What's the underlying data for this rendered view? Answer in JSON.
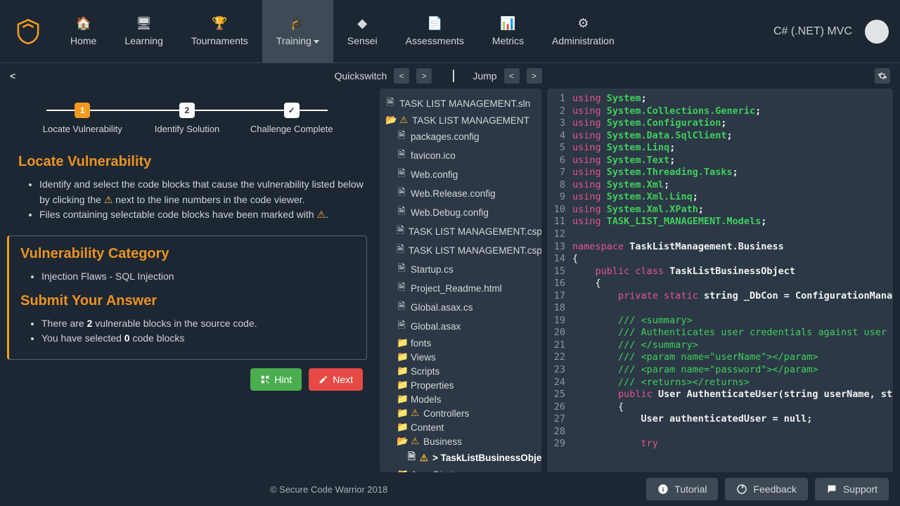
{
  "nav": {
    "items": [
      {
        "label": "Home"
      },
      {
        "label": "Learning"
      },
      {
        "label": "Tournaments"
      },
      {
        "label": "Training"
      },
      {
        "label": "Sensei"
      },
      {
        "label": "Assessments"
      },
      {
        "label": "Metrics"
      },
      {
        "label": "Administration"
      }
    ],
    "language": "C# (.NET) MVC"
  },
  "toolbar": {
    "quickswitch": "Quickswitch",
    "jump": "Jump"
  },
  "stepper": {
    "s1": "Locate Vulnerability",
    "s2": "Identify Solution",
    "s3": "Challenge Complete",
    "n1": "1",
    "n2": "2",
    "n3": "✓"
  },
  "left": {
    "heading1": "Locate Vulnerability",
    "inst1_a": "Identify and select the code blocks that cause the vulnerability listed below by clicking the ",
    "inst1_b": " next to the line numbers in the code viewer.",
    "inst2_a": "Files containing selectable code blocks have been marked with ",
    "inst2_b": ".",
    "cat_heading": "Vulnerability Category",
    "cat_value": "Injection Flaws - SQL Injection",
    "ans_heading": "Submit Your Answer",
    "ans1_a": "There are ",
    "ans1_b": "2",
    "ans1_c": " vulnerable blocks in the source code.",
    "ans2_a": "You have selected ",
    "ans2_b": "0",
    "ans2_c": " code blocks",
    "hint": "Hint",
    "next": "Next"
  },
  "tree": [
    {
      "depth": 0,
      "icon": "file",
      "warn": false,
      "label": "TASK LIST MANAGEMENT.sln",
      "sel": false
    },
    {
      "depth": 0,
      "icon": "folder-open",
      "warn": true,
      "label": "TASK LIST MANAGEMENT",
      "sel": false
    },
    {
      "depth": 1,
      "icon": "file",
      "warn": false,
      "label": "packages.config",
      "sel": false
    },
    {
      "depth": 1,
      "icon": "file",
      "warn": false,
      "label": "favicon.ico",
      "sel": false
    },
    {
      "depth": 1,
      "icon": "file",
      "warn": false,
      "label": "Web.config",
      "sel": false
    },
    {
      "depth": 1,
      "icon": "file",
      "warn": false,
      "label": "Web.Release.config",
      "sel": false
    },
    {
      "depth": 1,
      "icon": "file",
      "warn": false,
      "label": "Web.Debug.config",
      "sel": false
    },
    {
      "depth": 1,
      "icon": "file",
      "warn": false,
      "label": "TASK LIST MANAGEMENT.csproj",
      "sel": false
    },
    {
      "depth": 1,
      "icon": "file",
      "warn": false,
      "label": "TASK LIST MANAGEMENT.csproj.user",
      "sel": false
    },
    {
      "depth": 1,
      "icon": "file",
      "warn": false,
      "label": "Startup.cs",
      "sel": false
    },
    {
      "depth": 1,
      "icon": "file",
      "warn": false,
      "label": "Project_Readme.html",
      "sel": false
    },
    {
      "depth": 1,
      "icon": "file",
      "warn": false,
      "label": "Global.asax.cs",
      "sel": false
    },
    {
      "depth": 1,
      "icon": "file",
      "warn": false,
      "label": "Global.asax",
      "sel": false
    },
    {
      "depth": 1,
      "icon": "folder",
      "warn": false,
      "label": "fonts",
      "sel": false
    },
    {
      "depth": 1,
      "icon": "folder",
      "warn": false,
      "label": "Views",
      "sel": false
    },
    {
      "depth": 1,
      "icon": "folder",
      "warn": false,
      "label": "Scripts",
      "sel": false
    },
    {
      "depth": 1,
      "icon": "folder",
      "warn": false,
      "label": "Properties",
      "sel": false
    },
    {
      "depth": 1,
      "icon": "folder",
      "warn": false,
      "label": "Models",
      "sel": false
    },
    {
      "depth": 1,
      "icon": "folder",
      "warn": true,
      "label": "Controllers",
      "sel": false
    },
    {
      "depth": 1,
      "icon": "folder",
      "warn": false,
      "label": "Content",
      "sel": false
    },
    {
      "depth": 1,
      "icon": "folder-open",
      "warn": true,
      "label": "Business",
      "sel": false
    },
    {
      "depth": 2,
      "icon": "file",
      "warn": true,
      "label": "> TaskListBusinessObject.cs",
      "sel": true
    },
    {
      "depth": 1,
      "icon": "folder",
      "warn": false,
      "label": "App_Start",
      "sel": false
    }
  ],
  "code": [
    {
      "n": 1,
      "tokens": [
        [
          "key",
          "using "
        ],
        [
          "type",
          "System"
        ],
        [
          "plain",
          ";"
        ]
      ]
    },
    {
      "n": 2,
      "tokens": [
        [
          "key",
          "using "
        ],
        [
          "type",
          "System.Collections.Generic"
        ],
        [
          "plain",
          ";"
        ]
      ]
    },
    {
      "n": 3,
      "tokens": [
        [
          "key",
          "using "
        ],
        [
          "type",
          "System.Configuration"
        ],
        [
          "plain",
          ";"
        ]
      ]
    },
    {
      "n": 4,
      "tokens": [
        [
          "key",
          "using "
        ],
        [
          "type",
          "System.Data.SqlClient"
        ],
        [
          "plain",
          ";"
        ]
      ]
    },
    {
      "n": 5,
      "tokens": [
        [
          "key",
          "using "
        ],
        [
          "type",
          "System.Linq"
        ],
        [
          "plain",
          ";"
        ]
      ]
    },
    {
      "n": 6,
      "tokens": [
        [
          "key",
          "using "
        ],
        [
          "type",
          "System.Text"
        ],
        [
          "plain",
          ";"
        ]
      ]
    },
    {
      "n": 7,
      "tokens": [
        [
          "key",
          "using "
        ],
        [
          "type",
          "System.Threading.Tasks"
        ],
        [
          "plain",
          ";"
        ]
      ]
    },
    {
      "n": 8,
      "tokens": [
        [
          "key",
          "using "
        ],
        [
          "type",
          "System.Xml"
        ],
        [
          "plain",
          ";"
        ]
      ]
    },
    {
      "n": 9,
      "tokens": [
        [
          "key",
          "using "
        ],
        [
          "type",
          "System.Xml.Linq"
        ],
        [
          "plain",
          ";"
        ]
      ]
    },
    {
      "n": 10,
      "tokens": [
        [
          "key",
          "using "
        ],
        [
          "type",
          "System.Xml.XPath"
        ],
        [
          "plain",
          ";"
        ]
      ]
    },
    {
      "n": 11,
      "tokens": [
        [
          "key",
          "using "
        ],
        [
          "type",
          "TASK_LIST_MANAGEMENT.Models"
        ],
        [
          "plain",
          ";"
        ]
      ]
    },
    {
      "n": 12,
      "tokens": []
    },
    {
      "n": 13,
      "tokens": [
        [
          "key",
          "namespace "
        ],
        [
          "plain",
          "TaskListManagement.Business"
        ]
      ]
    },
    {
      "n": 14,
      "tokens": [
        [
          "brace",
          "{"
        ]
      ]
    },
    {
      "n": 15,
      "tokens": [
        [
          "plain",
          "    "
        ],
        [
          "mod",
          "public class "
        ],
        [
          "plain",
          "TaskListBusinessObject"
        ]
      ]
    },
    {
      "n": 16,
      "tokens": [
        [
          "brace",
          "    {"
        ]
      ]
    },
    {
      "n": 17,
      "tokens": [
        [
          "plain",
          "        "
        ],
        [
          "mod",
          "private static "
        ],
        [
          "plain",
          "string _DbCon = ConfigurationManager"
        ]
      ]
    },
    {
      "n": 18,
      "tokens": []
    },
    {
      "n": 19,
      "tokens": [
        [
          "plain",
          "        "
        ],
        [
          "com",
          "/// <summary>"
        ]
      ]
    },
    {
      "n": 20,
      "tokens": [
        [
          "plain",
          "        "
        ],
        [
          "com",
          "/// Authenticates user credentials against user"
        ]
      ]
    },
    {
      "n": 21,
      "tokens": [
        [
          "plain",
          "        "
        ],
        [
          "com",
          "/// </summary>"
        ]
      ]
    },
    {
      "n": 22,
      "tokens": [
        [
          "plain",
          "        "
        ],
        [
          "com",
          "/// <param name=\"userName\"></param>"
        ]
      ]
    },
    {
      "n": 23,
      "tokens": [
        [
          "plain",
          "        "
        ],
        [
          "com",
          "/// <param name=\"password\"></param>"
        ]
      ]
    },
    {
      "n": 24,
      "tokens": [
        [
          "plain",
          "        "
        ],
        [
          "com",
          "/// <returns></returns>"
        ]
      ]
    },
    {
      "n": 25,
      "tokens": [
        [
          "plain",
          "        "
        ],
        [
          "mod",
          "public "
        ],
        [
          "plain",
          "User AuthenticateUser(string userName, string"
        ]
      ]
    },
    {
      "n": 26,
      "tokens": [
        [
          "brace",
          "        {"
        ]
      ]
    },
    {
      "n": 27,
      "tokens": [
        [
          "plain",
          "            User authenticatedUser = null;"
        ]
      ]
    },
    {
      "n": 28,
      "tokens": []
    },
    {
      "n": 29,
      "tokens": [
        [
          "plain",
          "            "
        ],
        [
          "mod",
          "try"
        ]
      ]
    }
  ],
  "footer": {
    "copyright": "© Secure Code Warrior 2018",
    "tutorial": "Tutorial",
    "feedback": "Feedback",
    "support": "Support"
  }
}
